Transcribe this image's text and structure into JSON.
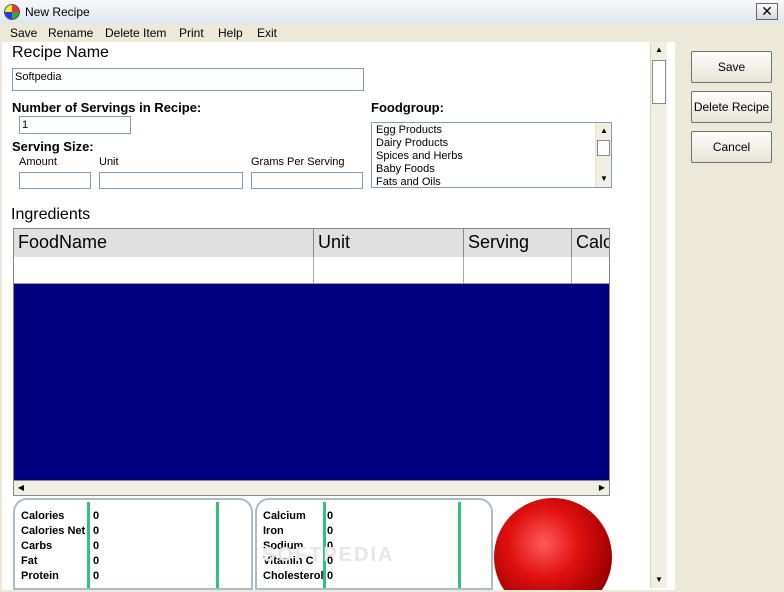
{
  "window": {
    "title": "New Recipe",
    "close_glyph": "✕"
  },
  "menu": [
    "Save",
    "Rename",
    "Delete Item",
    "Print",
    "Help",
    "Exit"
  ],
  "form": {
    "recipe_name_label": "Recipe Name",
    "recipe_name_value": "Softpedia",
    "servings_label": "Number of Servings in Recipe:",
    "servings_value": "1",
    "serving_size_label": "Serving Size:",
    "amount_label": "Amount",
    "unit_label": "Unit",
    "grams_label": "Grams Per Serving",
    "foodgroup_label": "Foodgroup:",
    "foodgroup_items": [
      "Egg Products",
      "Dairy Products",
      "Spices and Herbs",
      "Baby Foods",
      "Fats and Oils"
    ]
  },
  "ingredients": {
    "label": "Ingredients",
    "columns": [
      "FoodName",
      "Unit",
      "Serving",
      "Calo"
    ]
  },
  "nutrients_left": [
    {
      "name": "Calories",
      "value": "0"
    },
    {
      "name": "Calories Net",
      "value": "0"
    },
    {
      "name": "Carbs",
      "value": "0"
    },
    {
      "name": "Fat",
      "value": "0"
    },
    {
      "name": "Protein",
      "value": "0"
    }
  ],
  "nutrients_right": [
    {
      "name": "Calcium",
      "value": "0"
    },
    {
      "name": "Iron",
      "value": "0"
    },
    {
      "name": "Sodium",
      "value": "0"
    },
    {
      "name": "Vitamin C",
      "value": "0"
    },
    {
      "name": "Cholesterol",
      "value": "0"
    }
  ],
  "buttons": {
    "save": "Save",
    "delete": "Delete Recipe",
    "cancel": "Cancel"
  },
  "watermark": "SOFTPEDIA",
  "icons": {
    "up": "▲",
    "down": "▼",
    "left": "◀",
    "right": "▶"
  },
  "colors": {
    "grid_fill": "#000080",
    "accent_lines": "#2ec27e",
    "sphere": "#e01010"
  }
}
